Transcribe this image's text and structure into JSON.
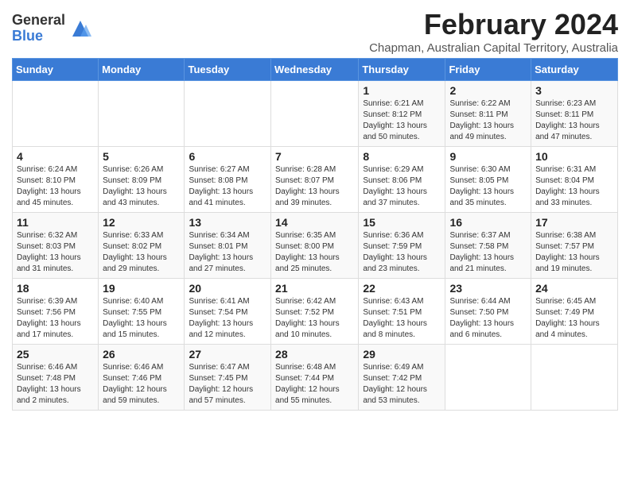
{
  "logo": {
    "general": "General",
    "blue": "Blue"
  },
  "title": "February 2024",
  "subtitle": "Chapman, Australian Capital Territory, Australia",
  "days_header": [
    "Sunday",
    "Monday",
    "Tuesday",
    "Wednesday",
    "Thursday",
    "Friday",
    "Saturday"
  ],
  "weeks": [
    [
      {
        "day": "",
        "info": ""
      },
      {
        "day": "",
        "info": ""
      },
      {
        "day": "",
        "info": ""
      },
      {
        "day": "",
        "info": ""
      },
      {
        "day": "1",
        "info": "Sunrise: 6:21 AM\nSunset: 8:12 PM\nDaylight: 13 hours\nand 50 minutes."
      },
      {
        "day": "2",
        "info": "Sunrise: 6:22 AM\nSunset: 8:11 PM\nDaylight: 13 hours\nand 49 minutes."
      },
      {
        "day": "3",
        "info": "Sunrise: 6:23 AM\nSunset: 8:11 PM\nDaylight: 13 hours\nand 47 minutes."
      }
    ],
    [
      {
        "day": "4",
        "info": "Sunrise: 6:24 AM\nSunset: 8:10 PM\nDaylight: 13 hours\nand 45 minutes."
      },
      {
        "day": "5",
        "info": "Sunrise: 6:26 AM\nSunset: 8:09 PM\nDaylight: 13 hours\nand 43 minutes."
      },
      {
        "day": "6",
        "info": "Sunrise: 6:27 AM\nSunset: 8:08 PM\nDaylight: 13 hours\nand 41 minutes."
      },
      {
        "day": "7",
        "info": "Sunrise: 6:28 AM\nSunset: 8:07 PM\nDaylight: 13 hours\nand 39 minutes."
      },
      {
        "day": "8",
        "info": "Sunrise: 6:29 AM\nSunset: 8:06 PM\nDaylight: 13 hours\nand 37 minutes."
      },
      {
        "day": "9",
        "info": "Sunrise: 6:30 AM\nSunset: 8:05 PM\nDaylight: 13 hours\nand 35 minutes."
      },
      {
        "day": "10",
        "info": "Sunrise: 6:31 AM\nSunset: 8:04 PM\nDaylight: 13 hours\nand 33 minutes."
      }
    ],
    [
      {
        "day": "11",
        "info": "Sunrise: 6:32 AM\nSunset: 8:03 PM\nDaylight: 13 hours\nand 31 minutes."
      },
      {
        "day": "12",
        "info": "Sunrise: 6:33 AM\nSunset: 8:02 PM\nDaylight: 13 hours\nand 29 minutes."
      },
      {
        "day": "13",
        "info": "Sunrise: 6:34 AM\nSunset: 8:01 PM\nDaylight: 13 hours\nand 27 minutes."
      },
      {
        "day": "14",
        "info": "Sunrise: 6:35 AM\nSunset: 8:00 PM\nDaylight: 13 hours\nand 25 minutes."
      },
      {
        "day": "15",
        "info": "Sunrise: 6:36 AM\nSunset: 7:59 PM\nDaylight: 13 hours\nand 23 minutes."
      },
      {
        "day": "16",
        "info": "Sunrise: 6:37 AM\nSunset: 7:58 PM\nDaylight: 13 hours\nand 21 minutes."
      },
      {
        "day": "17",
        "info": "Sunrise: 6:38 AM\nSunset: 7:57 PM\nDaylight: 13 hours\nand 19 minutes."
      }
    ],
    [
      {
        "day": "18",
        "info": "Sunrise: 6:39 AM\nSunset: 7:56 PM\nDaylight: 13 hours\nand 17 minutes."
      },
      {
        "day": "19",
        "info": "Sunrise: 6:40 AM\nSunset: 7:55 PM\nDaylight: 13 hours\nand 15 minutes."
      },
      {
        "day": "20",
        "info": "Sunrise: 6:41 AM\nSunset: 7:54 PM\nDaylight: 13 hours\nand 12 minutes."
      },
      {
        "day": "21",
        "info": "Sunrise: 6:42 AM\nSunset: 7:52 PM\nDaylight: 13 hours\nand 10 minutes."
      },
      {
        "day": "22",
        "info": "Sunrise: 6:43 AM\nSunset: 7:51 PM\nDaylight: 13 hours\nand 8 minutes."
      },
      {
        "day": "23",
        "info": "Sunrise: 6:44 AM\nSunset: 7:50 PM\nDaylight: 13 hours\nand 6 minutes."
      },
      {
        "day": "24",
        "info": "Sunrise: 6:45 AM\nSunset: 7:49 PM\nDaylight: 13 hours\nand 4 minutes."
      }
    ],
    [
      {
        "day": "25",
        "info": "Sunrise: 6:46 AM\nSunset: 7:48 PM\nDaylight: 13 hours\nand 2 minutes."
      },
      {
        "day": "26",
        "info": "Sunrise: 6:46 AM\nSunset: 7:46 PM\nDaylight: 12 hours\nand 59 minutes."
      },
      {
        "day": "27",
        "info": "Sunrise: 6:47 AM\nSunset: 7:45 PM\nDaylight: 12 hours\nand 57 minutes."
      },
      {
        "day": "28",
        "info": "Sunrise: 6:48 AM\nSunset: 7:44 PM\nDaylight: 12 hours\nand 55 minutes."
      },
      {
        "day": "29",
        "info": "Sunrise: 6:49 AM\nSunset: 7:42 PM\nDaylight: 12 hours\nand 53 minutes."
      },
      {
        "day": "",
        "info": ""
      },
      {
        "day": "",
        "info": ""
      }
    ]
  ]
}
